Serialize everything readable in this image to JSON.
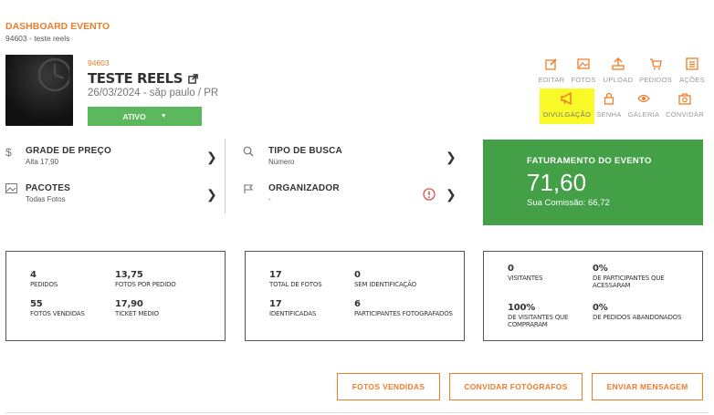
{
  "header": {
    "title": "DASHBOARD EVENTO",
    "subtitle": "94603 - teste reels"
  },
  "event": {
    "id": "94603",
    "name": "TESTE REELS",
    "date_location": "26/03/2024 - săp paulo / PR",
    "status": "ATIVO"
  },
  "actions_row1": [
    {
      "label": "EDITAR",
      "icon": "edit-icon"
    },
    {
      "label": "FOTOS",
      "icon": "photos-icon"
    },
    {
      "label": "UPLOAD",
      "icon": "upload-icon"
    },
    {
      "label": "PEDIDOS",
      "icon": "cart-icon"
    },
    {
      "label": "AÇÕES",
      "icon": "list-icon"
    }
  ],
  "actions_row2": [
    {
      "label": "DIVULGAÇÃO",
      "icon": "megaphone-icon"
    },
    {
      "label": "SENHA",
      "icon": "lock-icon"
    },
    {
      "label": "GALERIA",
      "icon": "eye-icon"
    },
    {
      "label": "CONVIDAR",
      "icon": "camera-icon"
    }
  ],
  "info": {
    "grade": {
      "title": "GRADE DE PREÇO",
      "value": "Alta 17,90"
    },
    "pacotes": {
      "title": "PACOTES",
      "value": "Todas Fotos"
    },
    "busca": {
      "title": "TIPO DE BUSCA",
      "value": "Número"
    },
    "organizador": {
      "title": "ORGANIZADOR",
      "value": "-"
    }
  },
  "faturamento": {
    "title": "FATURAMENTO DO EVENTO",
    "value": "71,60",
    "commission": "Sua Comissão: 66,72"
  },
  "stats1": [
    {
      "value": "4",
      "label": "PEDIDOS"
    },
    {
      "value": "13,75",
      "label": "FOTOS POR PEDIDO"
    },
    {
      "value": "55",
      "label": "FOTOS VENDIDAS"
    },
    {
      "value": "17,90",
      "label": "TICKET MÉDIO"
    }
  ],
  "stats2": [
    {
      "value": "17",
      "label": "TOTAL DE FOTOS"
    },
    {
      "value": "0",
      "label": "SEM IDENTIFICAÇÃO"
    },
    {
      "value": "17",
      "label": "IDENTIFICADAS"
    },
    {
      "value": "6",
      "label": "PARTICIPANTES FOTOGRAFADOS"
    }
  ],
  "stats3": [
    {
      "value": "0",
      "label": "VISITANTES"
    },
    {
      "value": "0%",
      "label": "DE PARTICIPANTES QUE ACESSARAM"
    },
    {
      "value": "100%",
      "label": "DE VISITANTES QUE COMPRARAM"
    },
    {
      "value": "0%",
      "label": "DE PEDIDOS ABANDONADOS"
    }
  ],
  "buttons": {
    "fotos_vendidas": "FOTOS VENDIDAS",
    "convidar": "CONVIDAR FOTÓGRAFOS",
    "mensagem": "ENVIAR MENSAGEM"
  },
  "colors": {
    "accent": "#f07c2a",
    "success": "#43a047",
    "status_button": "#5cb85c",
    "highlight": "#fafa28",
    "alert": "#d9534f"
  }
}
